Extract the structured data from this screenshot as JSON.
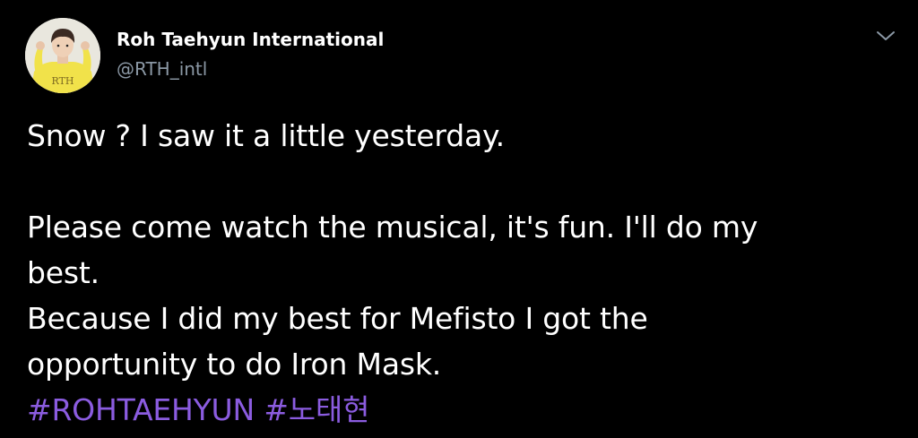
{
  "author": {
    "display_name": "Roh Taehyun International",
    "handle": "@RTH_intl",
    "avatar_text": "RTH"
  },
  "tweet": {
    "line1": "Snow ? I saw it a little yesterday.",
    "line2": "Please come watch the musical, it's fun. I'll do my",
    "line3": "best.",
    "line4": "Because I did my best for Mefisto I got the",
    "line5": "opportunity to do Iron Mask.",
    "hashtags": [
      "#ROHTAEHYUN",
      "#노태현"
    ]
  },
  "colors": {
    "background": "#000000",
    "text": "#ffffff",
    "secondary": "#8b98a5",
    "hashtag": "#8b5ce0",
    "avatar_shirt": "#f1e24a"
  },
  "icons": {
    "more": "chevron-down-icon"
  }
}
